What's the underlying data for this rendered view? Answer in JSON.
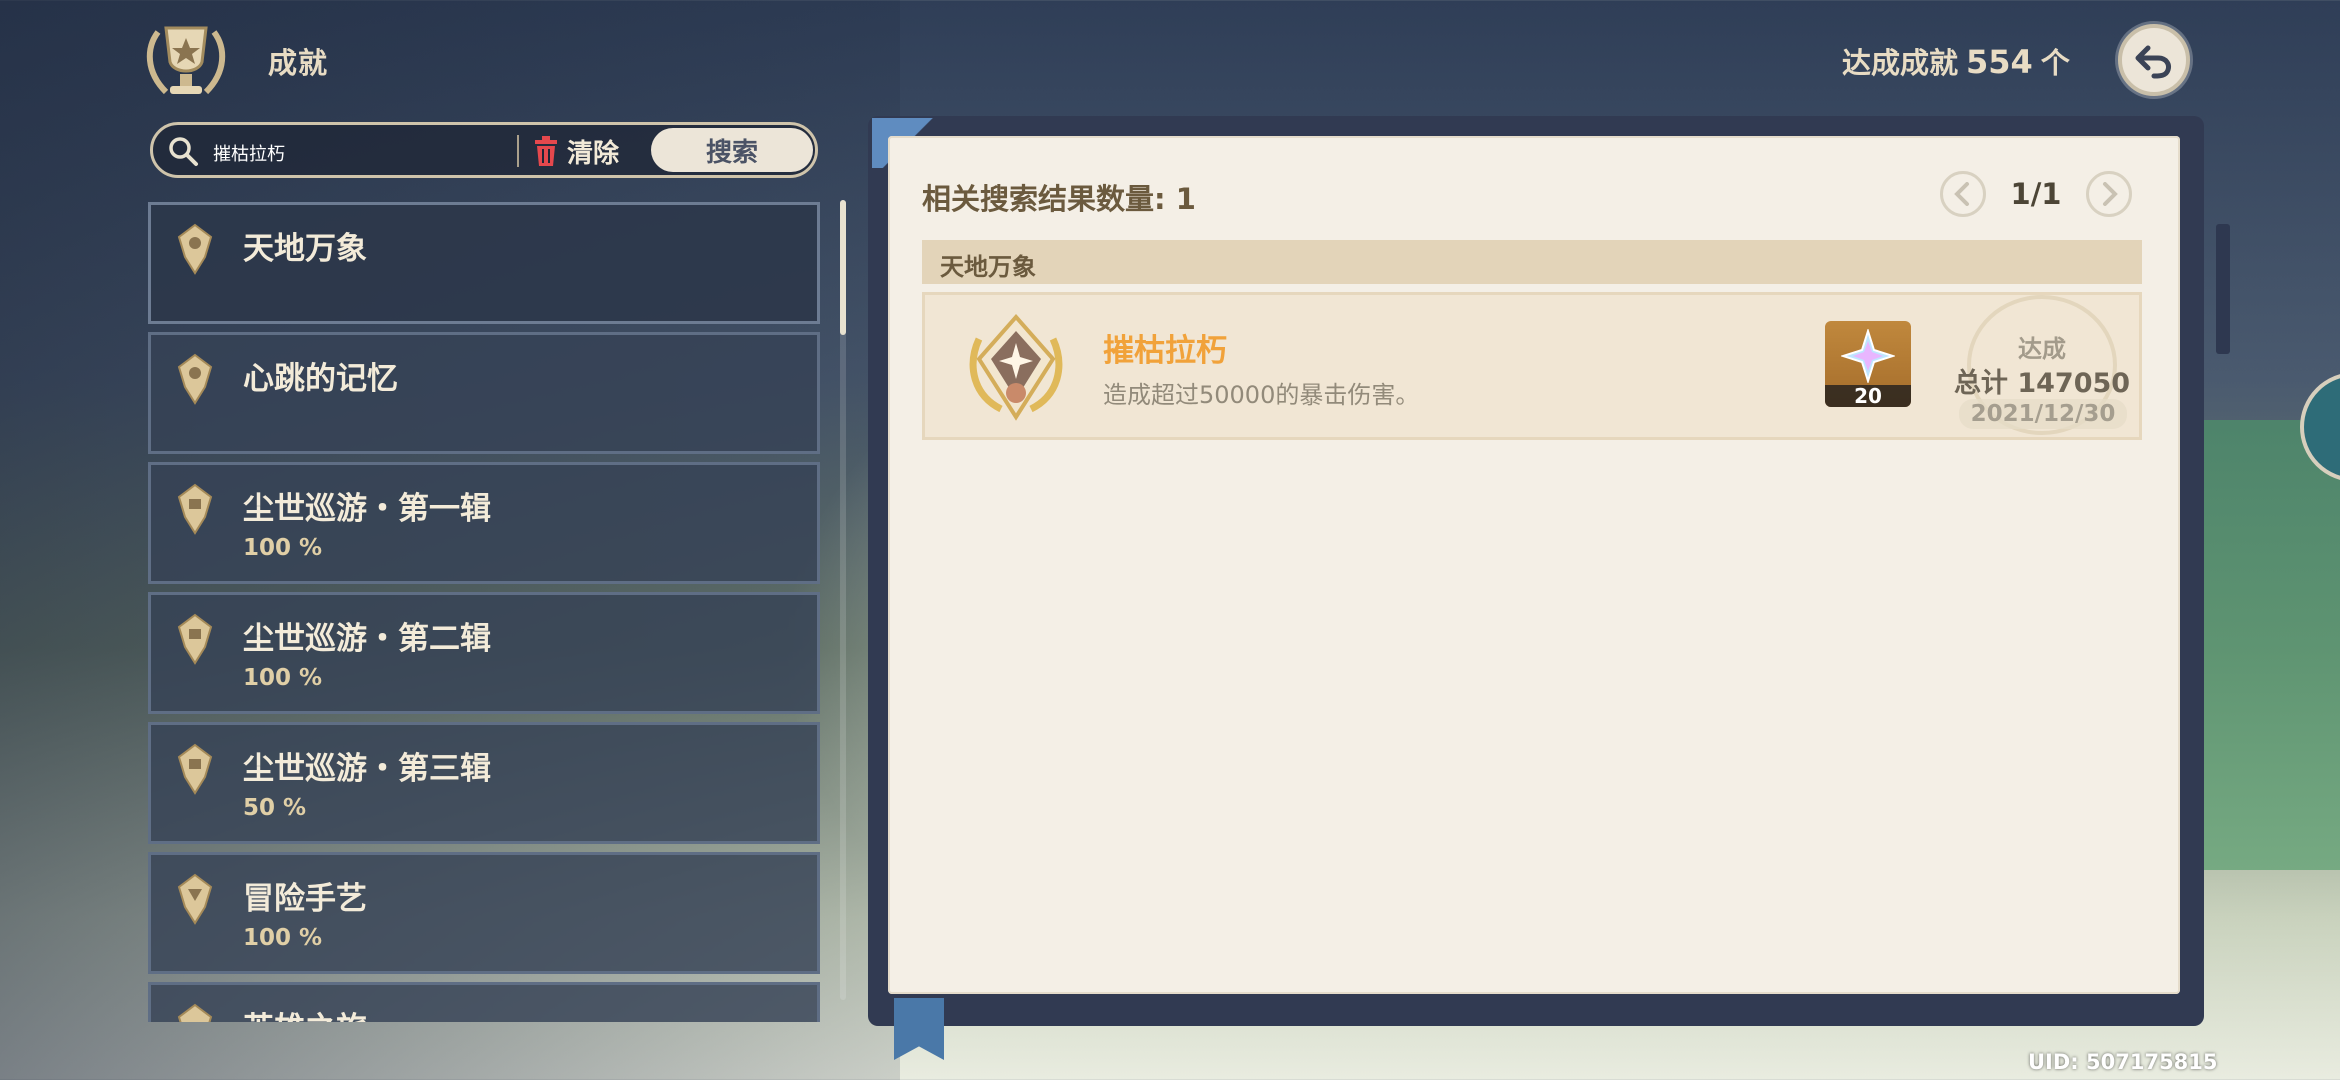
{
  "header": {
    "title": "成就",
    "achieved_label": "达成成就",
    "achieved_count": "554",
    "achieved_unit": "个"
  },
  "search": {
    "value": "摧枯拉朽",
    "clear_label": "清除",
    "search_label": "搜索"
  },
  "categories": [
    {
      "name": "天地万象",
      "progress": ""
    },
    {
      "name": "心跳的记忆",
      "progress": ""
    },
    {
      "name": "尘世巡游・第一辑",
      "progress": "100 %"
    },
    {
      "name": "尘世巡游・第二辑",
      "progress": "100 %"
    },
    {
      "name": "尘世巡游・第三辑",
      "progress": "50 %"
    },
    {
      "name": "冒险手艺",
      "progress": "100 %"
    },
    {
      "name": "英雄之旅",
      "progress": ""
    }
  ],
  "results": {
    "count_label": "相关搜索结果数量: 1",
    "page_indicator": "1/1",
    "section": "天地万象",
    "achievement": {
      "title": "摧枯拉朽",
      "description": "造成超过50000的暴击伤害。",
      "reward_count": "20",
      "status": "达成",
      "total": "总计 147050",
      "date": "2021/12/30"
    }
  },
  "footer": {
    "uid": "UID: 507175815"
  },
  "colors": {
    "accent": "#f1a23a",
    "page": "#f4efe6",
    "panel": "#313a52"
  }
}
